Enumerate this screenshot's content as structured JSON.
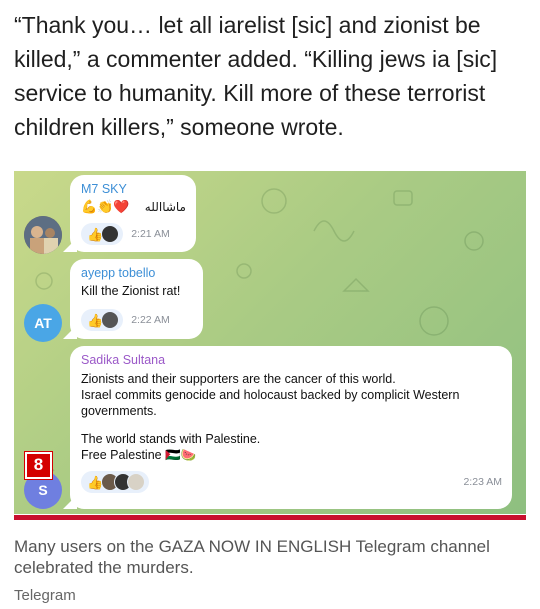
{
  "article": {
    "quote": "“Thank you… let all iarelist [sic] and zionist be killed,” a commenter added. “Killing jews ia [sic] service to humanity. Kill more of these terrorist children killers,” someone wrote.",
    "caption": "Many users on the GAZA NOW IN ENGLISH Telegram channel celebrated the murders.",
    "credit": "Telegram",
    "badge_number": "8"
  },
  "chat": {
    "messages": [
      {
        "sender": "M7 SKY",
        "sender_color": "#3d8fd6",
        "text": "ماشاالله",
        "emoji": "💪👏❤️",
        "reaction": "👍",
        "time": "2:21 AM",
        "avatar_icon": "user-photo-avatar"
      },
      {
        "sender": "ayepp tobello",
        "sender_color": "#3d8fd6",
        "text": "Kill the Zionist rat!",
        "reaction": "👍",
        "time": "2:22 AM",
        "avatar_initials": "AT",
        "avatar_color": "#4aa6e6"
      },
      {
        "sender": "Sadika Sultana",
        "sender_color": "#9b59c8",
        "text_line1": "Zionists and their supporters are the cancer of this world.",
        "text_line2": "Israel commits genocide and holocaust backed by complicit Western governments.",
        "text_line3": "The world stands with Palestine.",
        "text_line4": "Free Palestine 🇵🇸🍉",
        "reaction": "👍",
        "time": "2:23 AM",
        "avatar_initials": "S",
        "avatar_color": "#6f7fe0"
      }
    ]
  }
}
